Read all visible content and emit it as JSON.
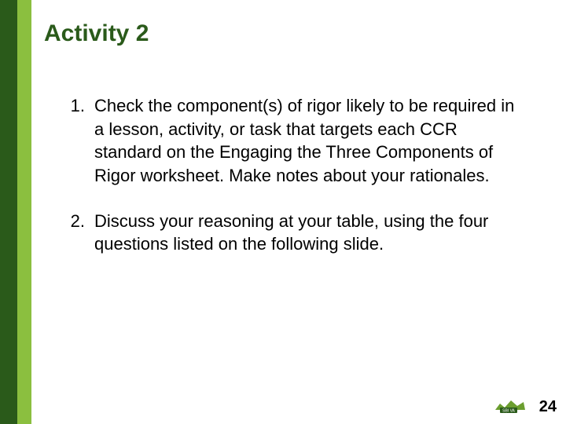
{
  "title": "Activity 2",
  "items": [
    {
      "num": "1.",
      "text": "Check the component(s) of rigor likely to be required in a lesson, activity, or task that targets each CCR standard on the Engaging the Three Components of Rigor worksheet. Make notes about your rationales."
    },
    {
      "num": "2.",
      "text": "Discuss your reasoning at your table, using the four questions listed on the following slide."
    }
  ],
  "page_number": "24",
  "logo_label": "SBI VA"
}
